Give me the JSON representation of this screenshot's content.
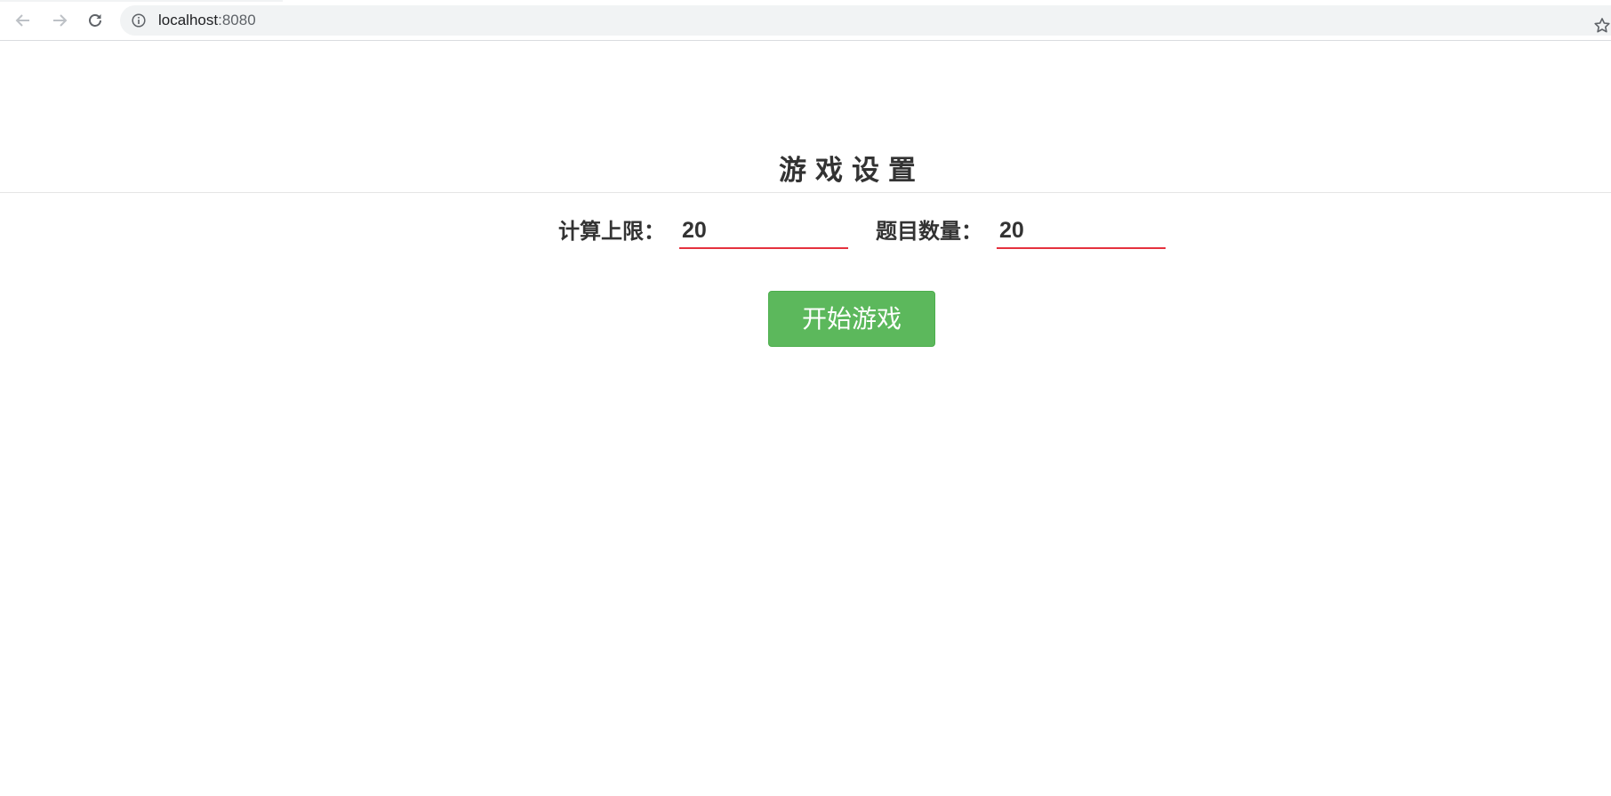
{
  "browser": {
    "url_host": "localhost",
    "url_port": ":8080"
  },
  "page": {
    "title": "游戏设置",
    "fields": [
      {
        "label": "计算上限：",
        "value": "20"
      },
      {
        "label": "题目数量：",
        "value": "20"
      }
    ],
    "start_button_label": "开始游戏"
  },
  "colors": {
    "accent_green": "#5cb85c",
    "input_underline": "#e5323e",
    "text": "#333333"
  },
  "icons": [
    "back-arrow-icon",
    "forward-arrow-icon",
    "reload-icon",
    "info-icon",
    "star-icon"
  ]
}
